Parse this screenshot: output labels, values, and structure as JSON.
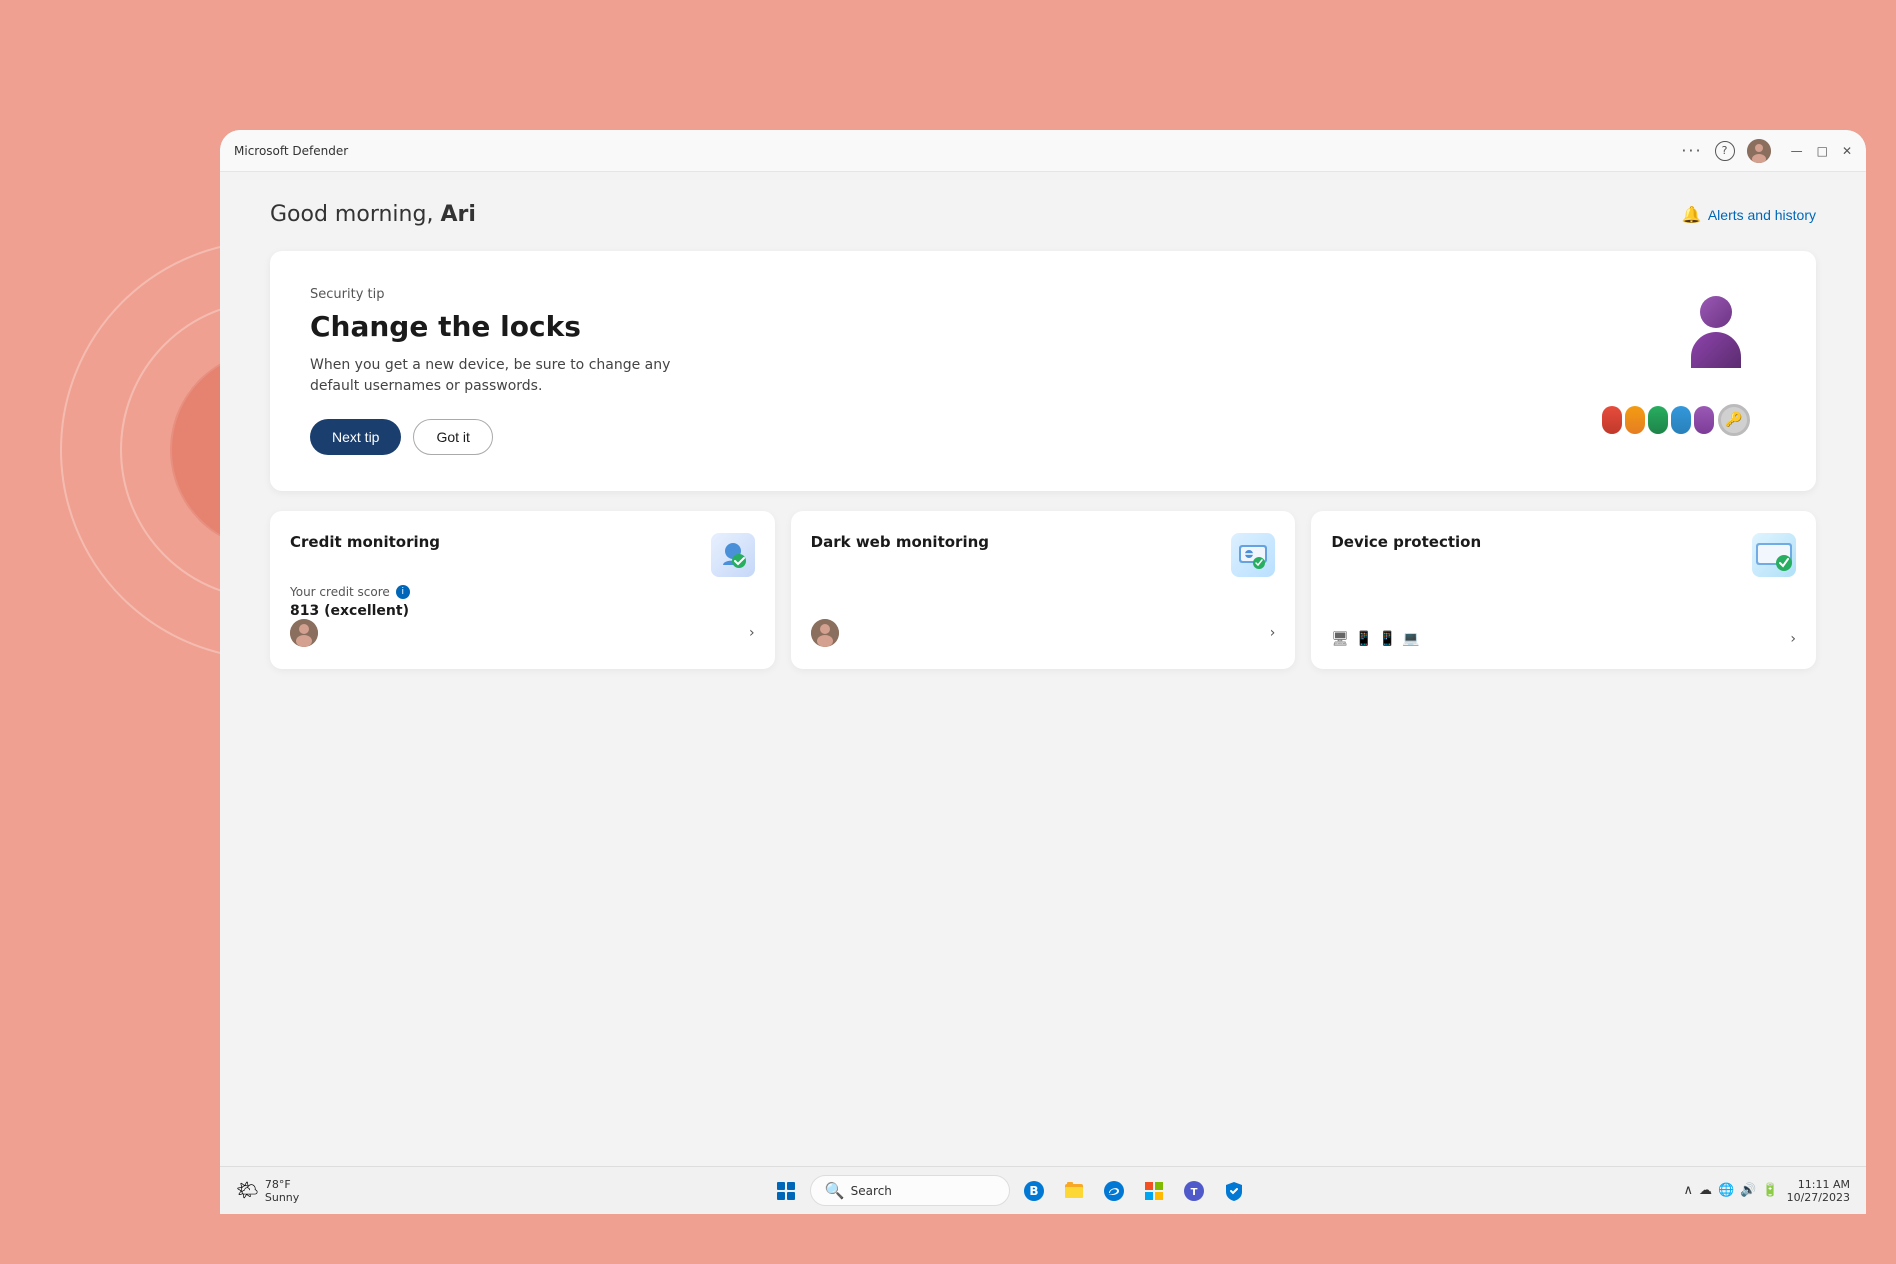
{
  "app": {
    "title": "Microsoft Defender",
    "title_display": "Microsoft Defender"
  },
  "titlebar": {
    "more_options": "···",
    "help": "?",
    "minimize": "—",
    "maximize": "□",
    "close": "✕"
  },
  "header": {
    "greeting_prefix": "Good morning, ",
    "greeting_name": "Ari",
    "alerts_label": "Alerts and history"
  },
  "security_tip": {
    "label": "Security tip",
    "title": "Change the locks",
    "description": "When you get a new device, be sure to change any default usernames or passwords.",
    "next_button": "Next tip",
    "got_it_button": "Got it"
  },
  "cards": {
    "credit_monitoring": {
      "title": "Credit monitoring",
      "subtitle": "Your credit score",
      "value": "813 (excellent)"
    },
    "dark_web": {
      "title": "Dark web monitoring"
    },
    "device_protection": {
      "title": "Device protection"
    }
  },
  "taskbar": {
    "weather_temp": "78°F",
    "weather_condition": "Sunny",
    "search_placeholder": "Search",
    "time": "11:11 AM",
    "date": "10/27/2023"
  }
}
